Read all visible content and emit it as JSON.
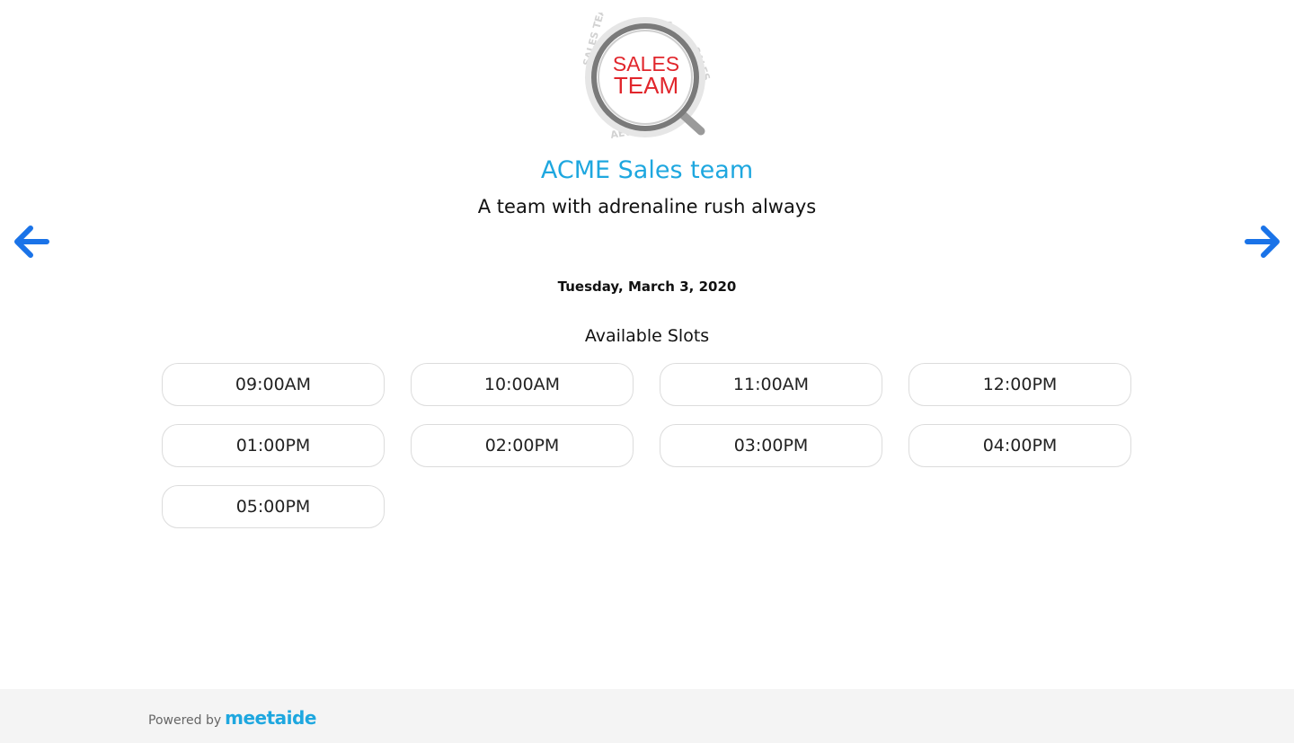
{
  "header": {
    "logo_text_line1": "SALES",
    "logo_text_line2": "TEAM",
    "team_name": "ACME Sales team",
    "tagline": "A team with adrenaline rush always"
  },
  "nav": {
    "prev_icon": "arrow-left-icon",
    "next_icon": "arrow-right-icon"
  },
  "date": "Tuesday, March 3, 2020",
  "slots": {
    "heading": "Available Slots",
    "items": [
      "09:00AM",
      "10:00AM",
      "11:00AM",
      "12:00PM",
      "01:00PM",
      "02:00PM",
      "03:00PM",
      "04:00PM",
      "05:00PM"
    ]
  },
  "footer": {
    "powered_by": "Powered by",
    "brand": "meetaide"
  },
  "colors": {
    "accent": "#1ea7df",
    "arrow": "#1a73e8",
    "logo_red": "#e1262c",
    "footer_bg": "#f4f4f4"
  }
}
